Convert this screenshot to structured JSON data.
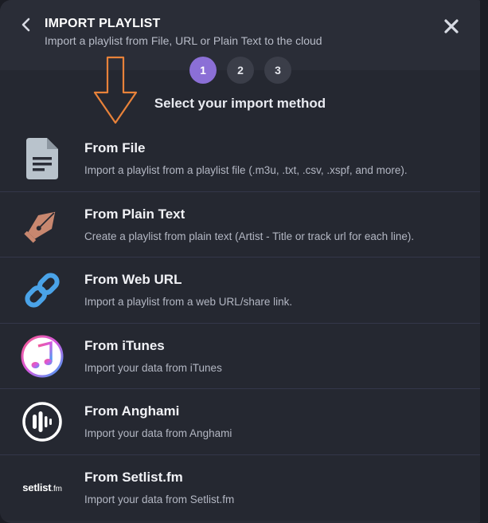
{
  "header": {
    "title": "IMPORT PLAYLIST",
    "subtitle": "Import a playlist from File, URL or Plain Text to the cloud"
  },
  "steps": [
    "1",
    "2",
    "3"
  ],
  "active_step": "1",
  "method_title": "Select your import method",
  "methods": [
    {
      "title": "From File",
      "desc": "Import a playlist from a playlist file (.m3u, .txt, .csv, .xspf, and more).",
      "icon": "file-icon"
    },
    {
      "title": "From Plain Text",
      "desc": "Create a playlist from plain text (Artist - Title or track url for each line).",
      "icon": "pen-nib-icon"
    },
    {
      "title": "From Web URL",
      "desc": "Import a playlist from a web URL/share link.",
      "icon": "link-icon"
    },
    {
      "title": "From iTunes",
      "desc": "Import your data from iTunes",
      "icon": "itunes-icon"
    },
    {
      "title": "From Anghami",
      "desc": "Import your data from Anghami",
      "icon": "anghami-icon"
    },
    {
      "title": "From Setlist.fm",
      "desc": "Import your data from Setlist.fm",
      "icon": "setlistfm-logo"
    }
  ],
  "setlist_logo": {
    "main": "setlist",
    "suffix": ".fm"
  },
  "colors": {
    "accent": "#8b6fd6",
    "arrow": "#e8823a",
    "link_blue": "#4aa3e8",
    "pen": "#c8876f"
  }
}
